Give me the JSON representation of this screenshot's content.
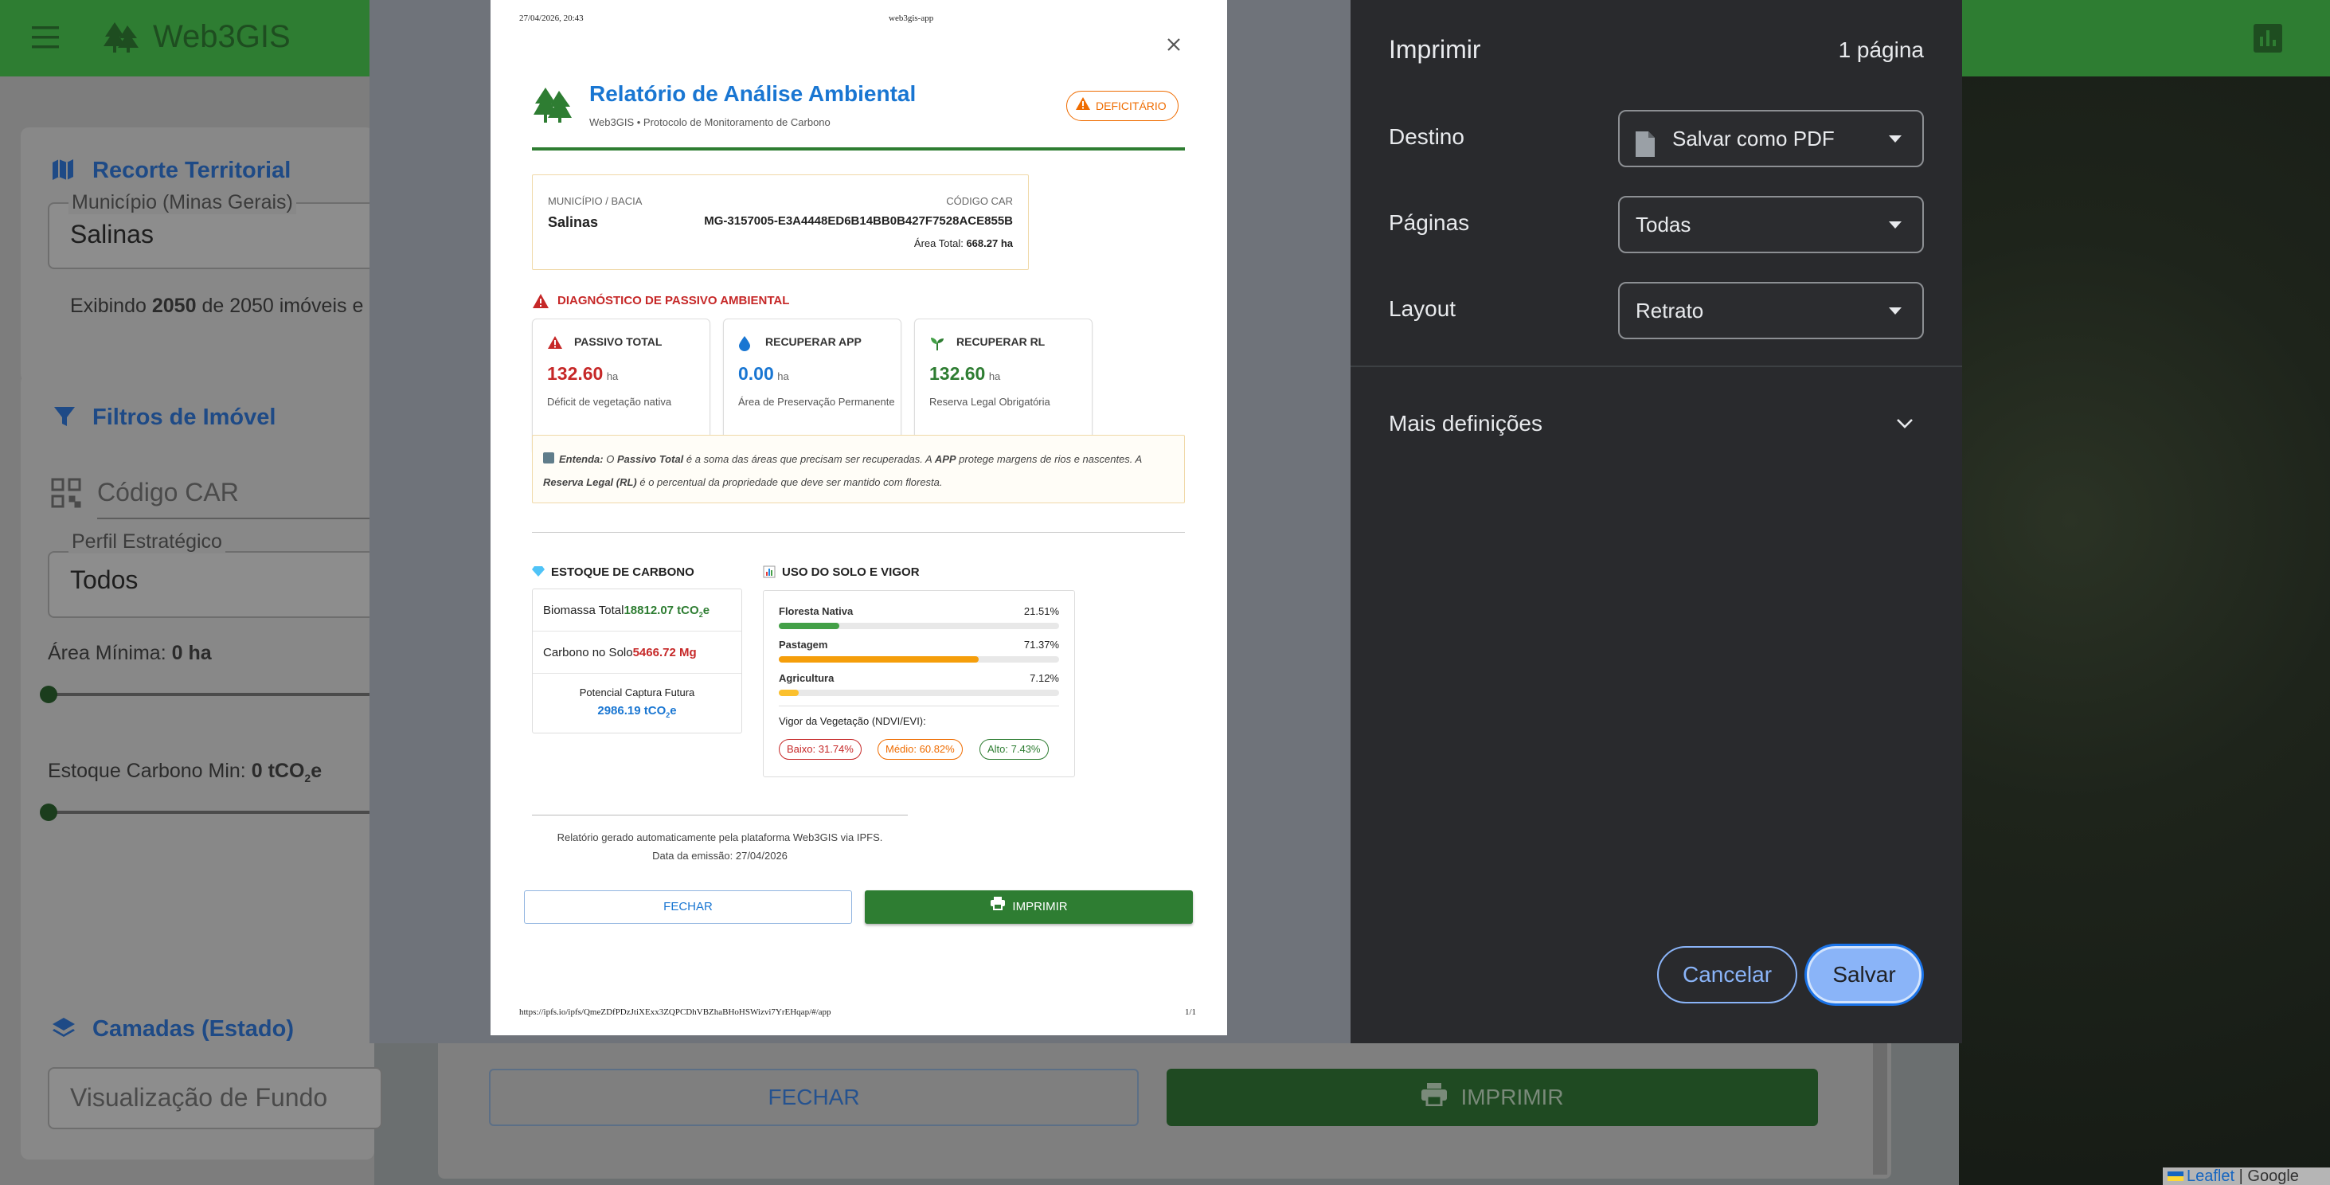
{
  "app": {
    "title": "Web3GIS",
    "menu_icon": "menu-icon",
    "logo_icon": "tree-icon",
    "chart_icon": "bar-chart-icon"
  },
  "sidebar": {
    "territorial": {
      "title": "Recorte Territorial",
      "municipio_label": "Município (Minas Gerais)",
      "municipio_value": "Salinas",
      "count_prefix": "Exibindo",
      "count_shown": "2050",
      "count_mid": "de 2050 imóveis e"
    },
    "filters": {
      "title": "Filtros de Imóvel",
      "car_placeholder": "Código CAR",
      "perfil_label": "Perfil Estratégico",
      "perfil_value": "Todos",
      "area_label": "Área Mínima:",
      "area_value": "0 ha",
      "area_min_fraction": 0,
      "carbono_label": "Estoque Carbono Min:",
      "carbono_value": "0 tCO",
      "carbono_sub": "2",
      "carbono_suffix": "e",
      "carbono_min_fraction": 0
    },
    "layers": {
      "title": "Camadas (Estado)",
      "background_placeholder": "Visualização de Fundo"
    }
  },
  "background_modal": {
    "close_label": "FECHAR",
    "print_label": "IMPRIMIR"
  },
  "map": {
    "attribution_leaflet": "Leaflet",
    "attribution_sep": "|",
    "attribution_google": "Google"
  },
  "print": {
    "title": "Imprimir",
    "page_count": "1 página",
    "destino_label": "Destino",
    "destino_value": "Salvar como PDF",
    "paginas_label": "Páginas",
    "paginas_value": "Todas",
    "layout_label": "Layout",
    "layout_value": "Retrato",
    "more_label": "Mais definições",
    "cancel_label": "Cancelar",
    "save_label": "Salvar"
  },
  "report": {
    "header_date": "27/04/2026, 20:43",
    "header_title": "web3gis-app",
    "footer_url": "https://ipfs.io/ipfs/QmeZDfPDzJtiXExx3ZQPCDhVBZhaBHoHSWizvi7YrEHqap/#/app",
    "footer_page": "1/1",
    "title": "Relatório de Análise Ambiental",
    "subtitle": "Web3GIS • Protocolo de Monitoramento de Carbono",
    "status_badge": "DEFICITÁRIO",
    "municipio_label": "MUNICÍPIO / BACIA",
    "municipio_value": "Salinas",
    "car_label": "CÓDIGO CAR",
    "car_value": "MG-3157005-E3A4448ED6B14BB0B427F7528ACE855B",
    "area_label": "Área Total:",
    "area_value": "668.27 ha",
    "diag_title": "DIAGNÓSTICO DE PASSIVO AMBIENTAL",
    "cards": [
      {
        "title": "PASSIVO TOTAL",
        "value": "132.60",
        "unit": "ha",
        "desc": "Déficit de vegetação nativa",
        "color": "#c62828",
        "icon": "warning-icon"
      },
      {
        "title": "RECUPERAR APP",
        "value": "0.00",
        "unit": "ha",
        "desc": "Área de Preservação Permanente",
        "color": "#1976d2",
        "icon": "water-drop-icon"
      },
      {
        "title": "RECUPERAR RL",
        "value": "132.60",
        "unit": "ha",
        "desc": "Reserva Legal Obrigatória",
        "color": "#2e7d32",
        "icon": "sprout-icon"
      }
    ],
    "info_entenda": "Entenda:",
    "info_t1": " O ",
    "info_passivo": "Passivo Total",
    "info_t2": " é a soma das áreas que precisam ser recuperadas. A ",
    "info_app": "APP",
    "info_t3": " protege margens de rios e nascentes. A ",
    "info_rl": "Reserva Legal (RL)",
    "info_t4": " é o percentual da propriedade que deve ser mantido com floresta.",
    "carbon_title": "ESTOQUE DE CARBONO",
    "biomassa_label": "Biomassa Total",
    "biomassa_value": "18812.07 tCO",
    "biomassa_sub": "2",
    "biomassa_suffix": "e",
    "solo_label": "Carbono no Solo",
    "solo_value": "5466.72 Mg",
    "captura_label": "Potencial Captura Futura",
    "captura_value": "2986.19 tCO",
    "captura_sub": "2",
    "captura_suffix": "e",
    "landuse_title": "USO DO SOLO E VIGOR",
    "landuse": [
      {
        "label": "Floresta Nativa",
        "percent": "21.51%",
        "fraction": 0.2151,
        "color": "#43a047"
      },
      {
        "label": "Pastagem",
        "percent": "71.37%",
        "fraction": 0.7137,
        "color": "#f59e0b"
      },
      {
        "label": "Agricultura",
        "percent": "7.12%",
        "fraction": 0.0712,
        "color": "#fbc02d"
      }
    ],
    "vigor_label": "Vigor da Vegetação (NDVI/EVI):",
    "vigor": [
      {
        "label": "Baixo: 31.74%",
        "color": "#c62828"
      },
      {
        "label": "Médio: 60.82%",
        "color": "#ef6c00"
      },
      {
        "label": "Alto: 7.43%",
        "color": "#2e7d32"
      }
    ],
    "gen_line1": "Relatório gerado automaticamente pela plataforma Web3GIS via IPFS.",
    "gen_line2": "Data da emissão: 27/04/2026",
    "close_label": "FECHAR",
    "print_label": "IMPRIMIR"
  },
  "colors": {
    "brand_green": "#2e7d32",
    "accent_blue": "#1976d2",
    "danger_red": "#c62828",
    "print_accent": "#8ab4f8"
  }
}
